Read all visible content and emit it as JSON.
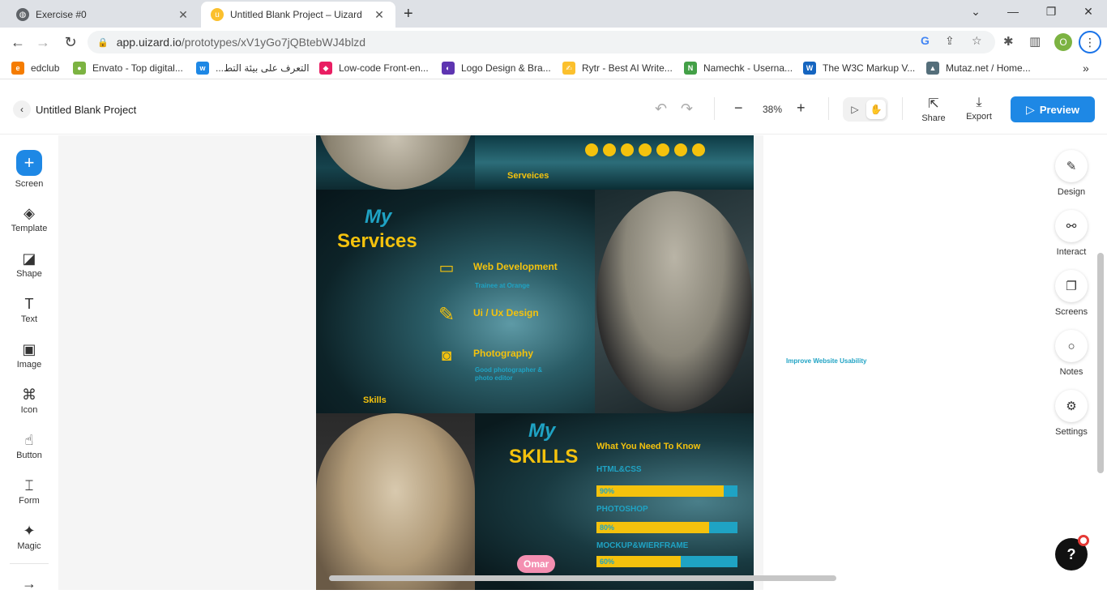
{
  "browser": {
    "tabs": [
      {
        "title": "Exercise #0",
        "active": false
      },
      {
        "title": "Untitled Blank Project – Uizard",
        "active": true
      }
    ],
    "url_host": "app.uizard.io",
    "url_path": "/prototypes/xV1yGo7jQBtebWJ4blzd",
    "profile_initial": "O",
    "bookmarks": [
      {
        "label": "edclub",
        "color": "#f57c00"
      },
      {
        "label": "Envato - Top digital...",
        "color": "#7cb342"
      },
      {
        "label": "التعرف على بيئة التط...",
        "color": "#1e88e5"
      },
      {
        "label": "Low-code Front-en...",
        "color": "#e91e63"
      },
      {
        "label": "Logo Design & Bra...",
        "color": "#5e35b1"
      },
      {
        "label": "Rytr - Best AI Write...",
        "color": "#fbc02d"
      },
      {
        "label": "Namechk - Userna...",
        "color": "#43a047"
      },
      {
        "label": "The W3C Markup V...",
        "color": "#1565c0"
      },
      {
        "label": "Mutaz.net / Home...",
        "color": "#546e7a"
      }
    ],
    "bookmarks_more": "»"
  },
  "header": {
    "project_title": "Untitled Blank Project",
    "zoom": "38%",
    "share_label": "Share",
    "export_label": "Export",
    "preview_label": "Preview"
  },
  "left_tools": [
    {
      "label": "Screen",
      "icon": "+"
    },
    {
      "label": "Template",
      "icon": "◈"
    },
    {
      "label": "Shape",
      "icon": "◪"
    },
    {
      "label": "Text",
      "icon": "T"
    },
    {
      "label": "Image",
      "icon": "▣"
    },
    {
      "label": "Icon",
      "icon": "⌘"
    },
    {
      "label": "Button",
      "icon": "☝"
    },
    {
      "label": "Form",
      "icon": "⌶"
    },
    {
      "label": "Magic",
      "icon": "✦"
    }
  ],
  "left_bottom_icon": "→",
  "right_tools": [
    {
      "label": "Design",
      "icon": "✎"
    },
    {
      "label": "Interact",
      "icon": "⚯"
    },
    {
      "label": "Screens",
      "icon": "❐"
    },
    {
      "label": "Notes",
      "icon": "○"
    },
    {
      "label": "Settings",
      "icon": "⚙"
    }
  ],
  "board": {
    "serveices_label": "Serveices",
    "services": {
      "heading_my": "My",
      "heading_main": "Services",
      "items": [
        {
          "title": "Web Development",
          "subtitle": "Trainee at Orange",
          "icon": "laptop-icon",
          "glyph": "▭"
        },
        {
          "title": "Ui / Ux Design",
          "subtitle": "",
          "icon": "pencil-icon",
          "glyph": "✎"
        },
        {
          "title": "Photography",
          "subtitle": "Good photographer & photo editor",
          "icon": "camera-icon",
          "glyph": "◙"
        }
      ],
      "skills_label": "Skills"
    },
    "skills": {
      "heading_my": "My",
      "heading_main": "SKILLS",
      "subheading": "What You Need To Know",
      "items": [
        {
          "name": "HTML&CSS",
          "percent": 90,
          "label": "90%"
        },
        {
          "name": "PHOTOSHOP",
          "percent": 80,
          "label": "80%"
        },
        {
          "name": "MOCKUP&WIERFRAME",
          "percent": 60,
          "label": "60%"
        }
      ]
    },
    "cursor_user": "Omar"
  },
  "floating_label": "Improve Website Usability",
  "help_label": "?",
  "colors": {
    "accent": "#1e88e5",
    "yellow": "#f4c20d",
    "cyan": "#1fa3c4"
  }
}
